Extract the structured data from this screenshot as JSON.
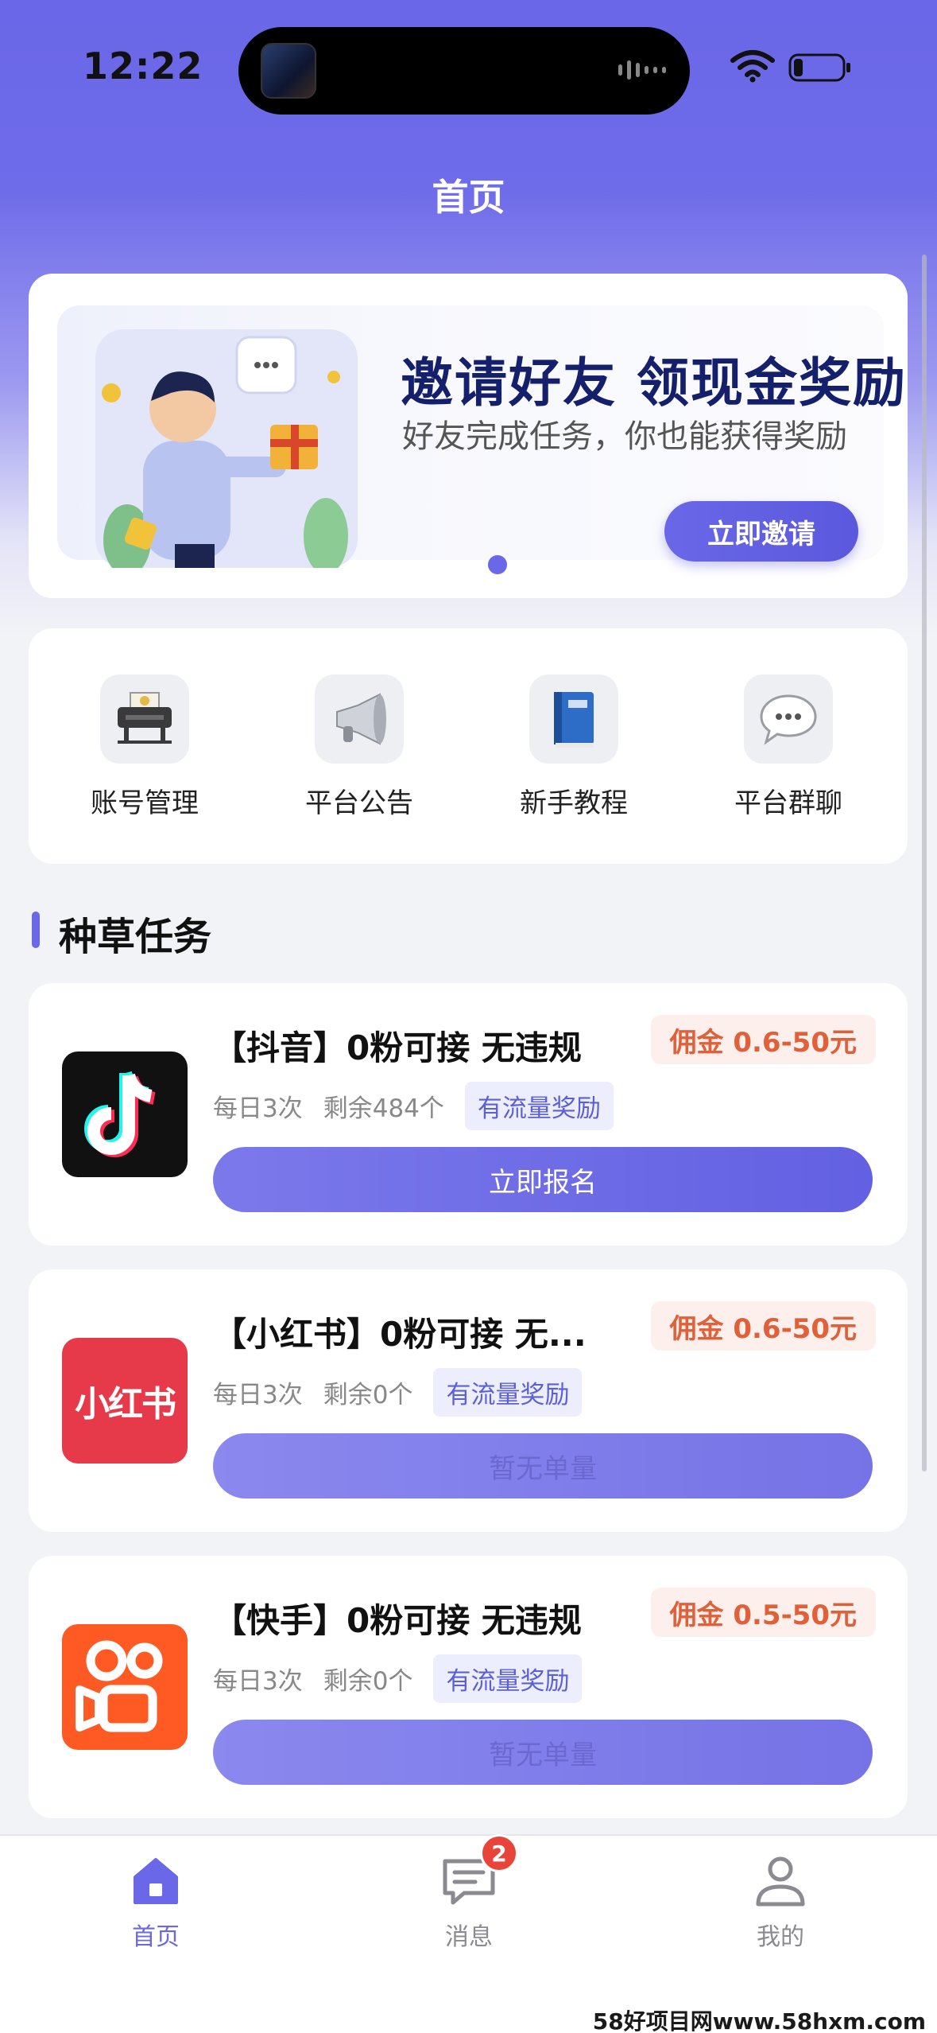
{
  "status_bar": {
    "time": "12:22"
  },
  "header": {
    "title": "首页"
  },
  "banner": {
    "title": "邀请好友 领现金奖励",
    "subtitle": "好友完成任务，你也能获得奖励",
    "button": "立即邀请"
  },
  "quick_menu": [
    {
      "label": "账号管理",
      "icon": "printer-icon"
    },
    {
      "label": "平台公告",
      "icon": "megaphone-icon"
    },
    {
      "label": "新手教程",
      "icon": "book-icon"
    },
    {
      "label": "平台群聊",
      "icon": "chat-bubble-icon"
    }
  ],
  "section": {
    "title": "种草任务"
  },
  "tasks": [
    {
      "title": "【抖音】0粉可接 无违规",
      "fee": "佣金 0.6-50元",
      "daily": "每日3次",
      "remaining": "剩余484个",
      "tag": "有流量奖励",
      "button": "立即报名",
      "logo": "douyin-logo"
    },
    {
      "title": "【小红书】0粉可接 无...",
      "fee": "佣金 0.6-50元",
      "daily": "每日3次",
      "remaining": "剩余0个",
      "tag": "有流量奖励",
      "button": "暂无单量",
      "logo_text": "小红书"
    },
    {
      "title": "【快手】0粉可接 无违规",
      "fee": "佣金 0.5-50元",
      "daily": "每日3次",
      "remaining": "剩余0个",
      "tag": "有流量奖励",
      "button": "暂无单量",
      "logo": "kuaishou-logo"
    }
  ],
  "tabbar": {
    "home": "首页",
    "messages": "消息",
    "messages_badge": "2",
    "mine": "我的"
  },
  "watermark": "58好项目网www.58hxm.com",
  "colors": {
    "accent": "#6a67e8",
    "fee": "#e0603a",
    "badge": "#e8443a"
  }
}
